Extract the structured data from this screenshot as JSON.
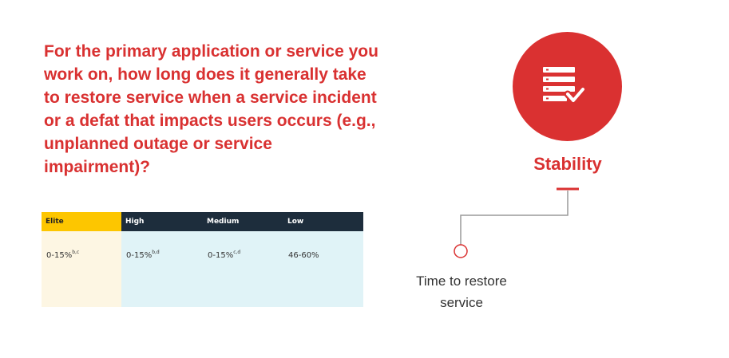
{
  "question": "For the primary application or service you work on, how long does it generally take to restore service when a service incident or a defat that impacts users occurs (e.g., unplanned outage or service impairment)?",
  "tiers": [
    {
      "label": "Elite",
      "value": "0-15%",
      "sup": "b,c"
    },
    {
      "label": "High",
      "value": "0-15%",
      "sup": "b,d"
    },
    {
      "label": "Medium",
      "value": "0-15%",
      "sup": "c,d"
    },
    {
      "label": "Low",
      "value": "46-60%",
      "sup": ""
    }
  ],
  "category": {
    "label": "Stability",
    "icon": "server-check-icon",
    "color": "#da3131"
  },
  "metric": {
    "line1": "Time to restore",
    "line2": "service"
  },
  "colors": {
    "elite": "#fdc600",
    "header_dark": "#1d2d3c",
    "accent_red": "#da3131"
  }
}
